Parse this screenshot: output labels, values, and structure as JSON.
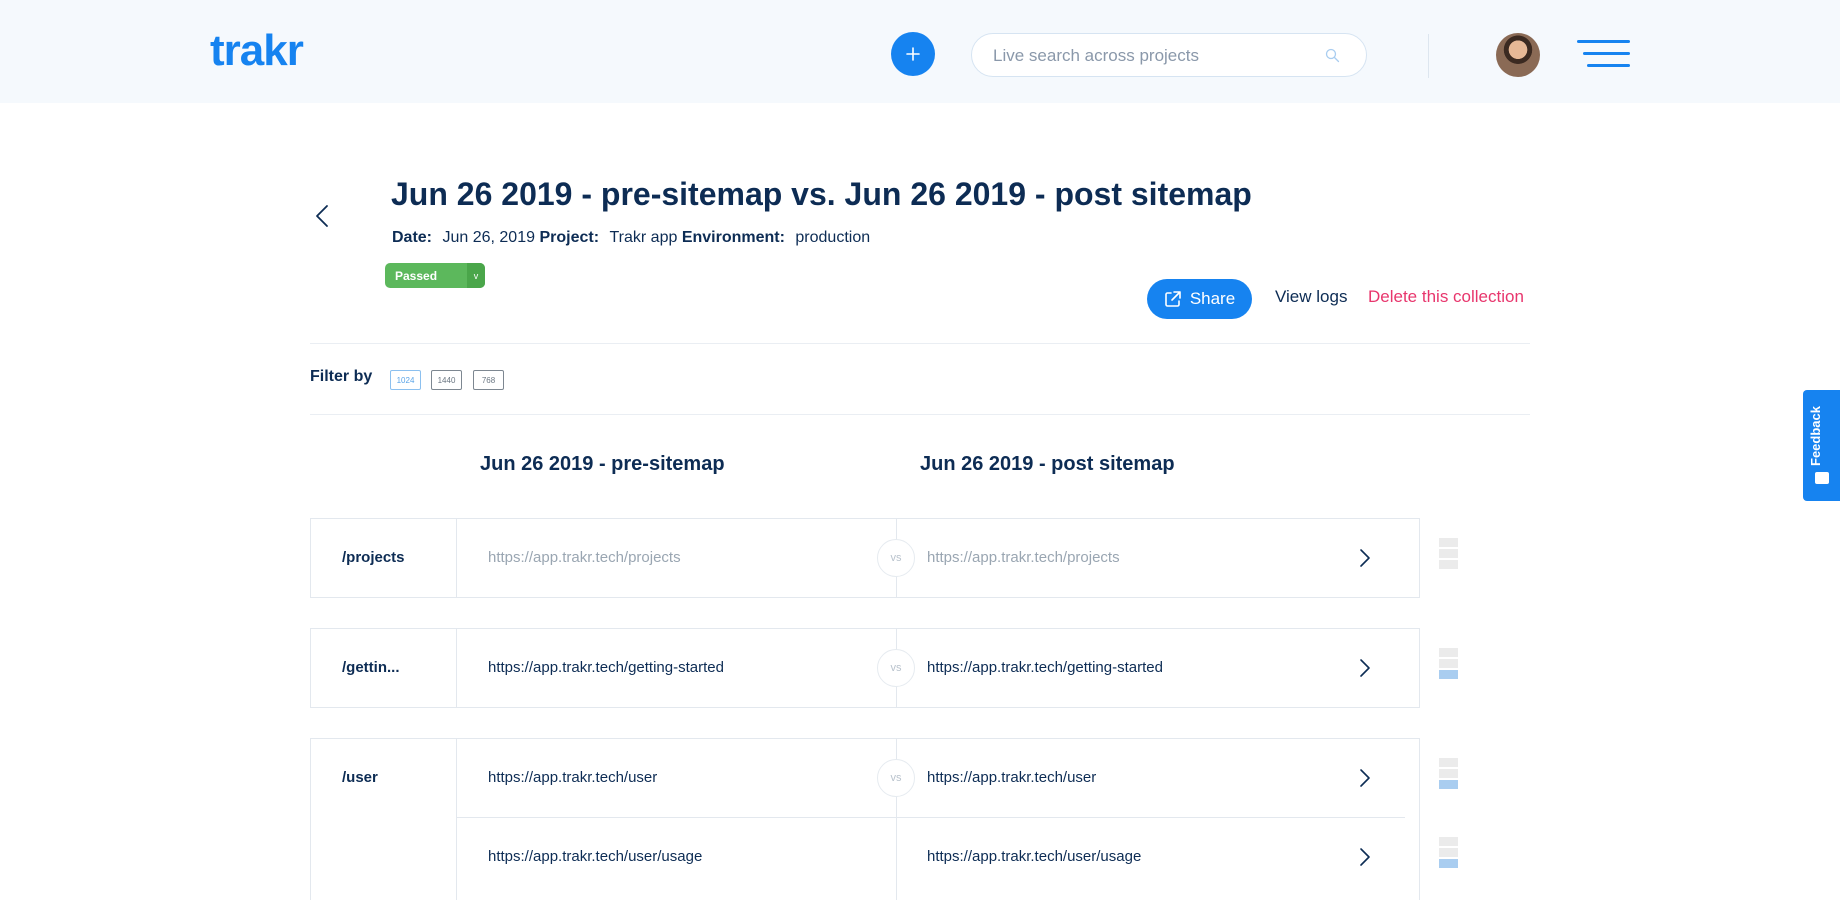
{
  "header": {
    "logo": "trakr",
    "search_placeholder": "Live search across projects"
  },
  "comparison": {
    "title": "Jun 26 2019 - pre-sitemap vs. Jun 26 2019 - post sitemap",
    "date_label": "Date:",
    "date_value": "Jun 26, 2019",
    "project_label": "Project:",
    "project_value": "Trakr app",
    "environment_label": "Environment:",
    "environment_value": "production",
    "status": "Passed",
    "status_caret": "v",
    "status_color": "#5cb85c"
  },
  "actions": {
    "share": "Share",
    "view_logs": "View logs",
    "delete": "Delete this collection"
  },
  "filter": {
    "label": "Filter by",
    "options": [
      "1024",
      "1440",
      "768"
    ],
    "active": "1024"
  },
  "columns": {
    "left": "Jun 26 2019 - pre-sitemap",
    "right": "Jun 26 2019 - post sitemap"
  },
  "vs_label": "vs",
  "rows": [
    {
      "path": "/projects",
      "left_url": "https://app.trakr.tech/projects",
      "right_url": "https://app.trakr.tech/projects"
    },
    {
      "path": "/gettin...",
      "left_url": "https://app.trakr.tech/getting-started",
      "right_url": "https://app.trakr.tech/getting-started"
    },
    {
      "path": "/user",
      "left_url": "https://app.trakr.tech/user",
      "right_url": "https://app.trakr.tech/user"
    },
    {
      "path": "",
      "left_url": "https://app.trakr.tech/user/usage",
      "right_url": "https://app.trakr.tech/user/usage"
    }
  ],
  "feedback_tab": "Feedback",
  "colors": {
    "brand": "#1683f0",
    "danger": "#e8366d",
    "text": "#0d2c54"
  }
}
